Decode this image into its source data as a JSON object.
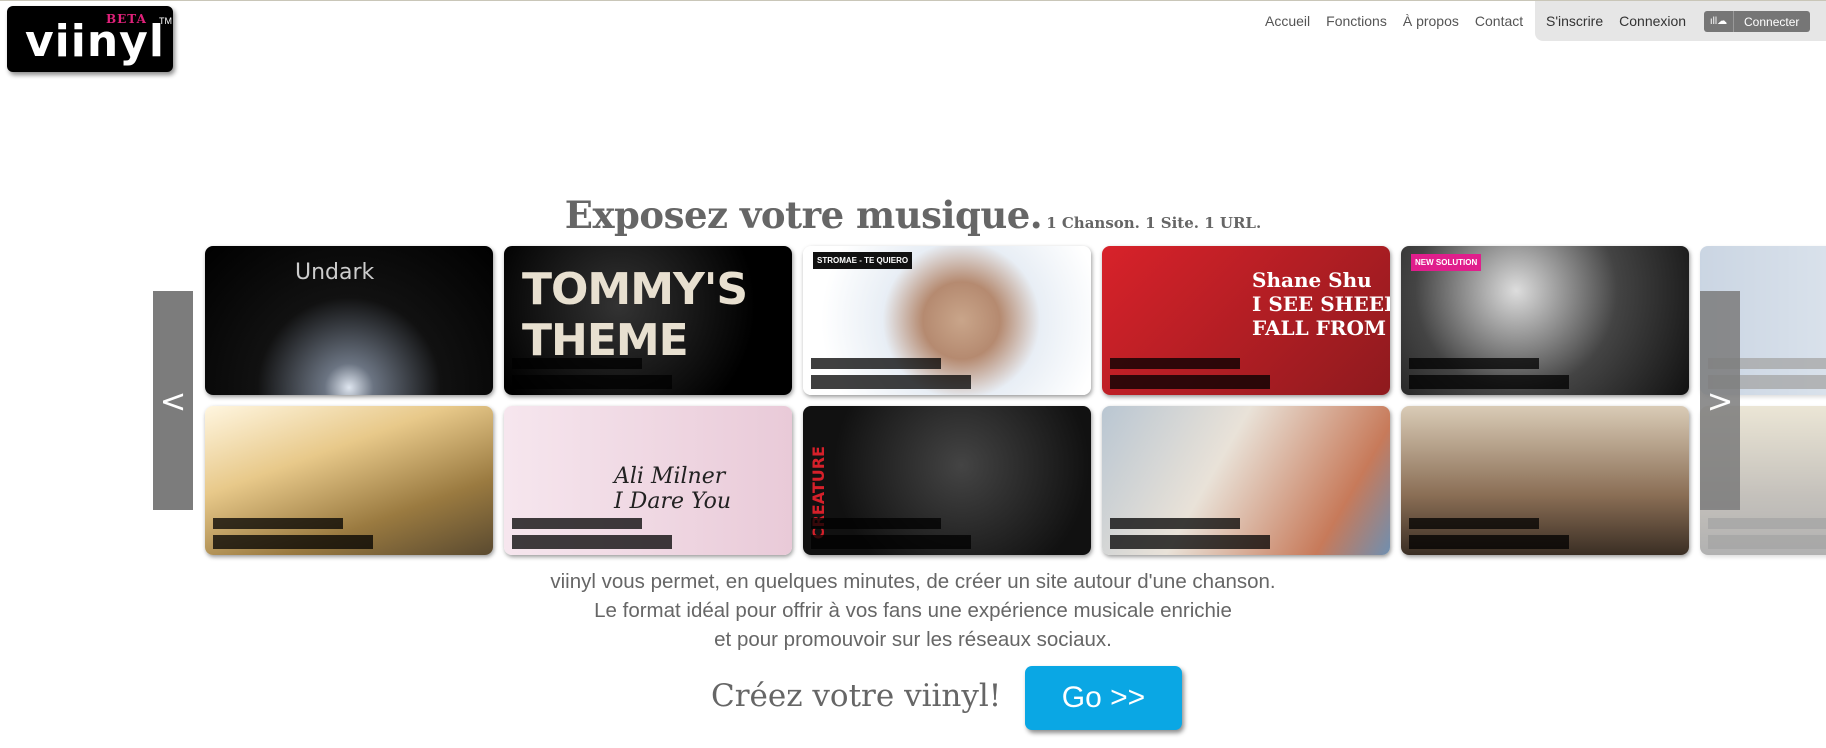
{
  "logo": {
    "word": "viinyl",
    "beta": "BETA",
    "tm": "TM"
  },
  "nav": {
    "items": [
      "Accueil",
      "Fonctions",
      "À propos",
      "Contact"
    ]
  },
  "account": {
    "signup": "S'inscrire",
    "login": "Connexion",
    "soundcloud_icon": "soundcloud-icon",
    "connect": "Connecter"
  },
  "hero": {
    "title": "Exposez votre musique.",
    "tagline": "1 Chanson. 1 Site. 1 URL."
  },
  "carousel": {
    "prev": "<",
    "next": ">",
    "thumbnails": [
      {
        "title": "Undark"
      },
      {
        "title": "TOMMY'S\nTHEME"
      },
      {
        "title": "STROMAE - TE QUIERO"
      },
      {
        "title": "Shane Shu\nI SEE SHEEP\nFALL FROM THE SKY"
      },
      {
        "title": "NEW SOLUTION"
      },
      {
        "title": ""
      },
      {
        "title": ""
      },
      {
        "title": "Ali Milner\nI Dare You"
      },
      {
        "title": "CREATURE"
      },
      {
        "title": ""
      },
      {
        "title": ""
      },
      {
        "title": ""
      }
    ]
  },
  "description": [
    "viinyl vous permet, en quelques minutes, de créer un site autour d'une chanson.",
    "Le format idéal pour offrir à vos fans une expérience musicale enrichie",
    "et pour promouvoir sur les réseaux sociaux."
  ],
  "cta": {
    "text": "Créez votre viinyl!",
    "button": "Go >>"
  },
  "colors": {
    "accent": "#0aa7e4",
    "beta": "#e0217a",
    "text": "#666666"
  }
}
